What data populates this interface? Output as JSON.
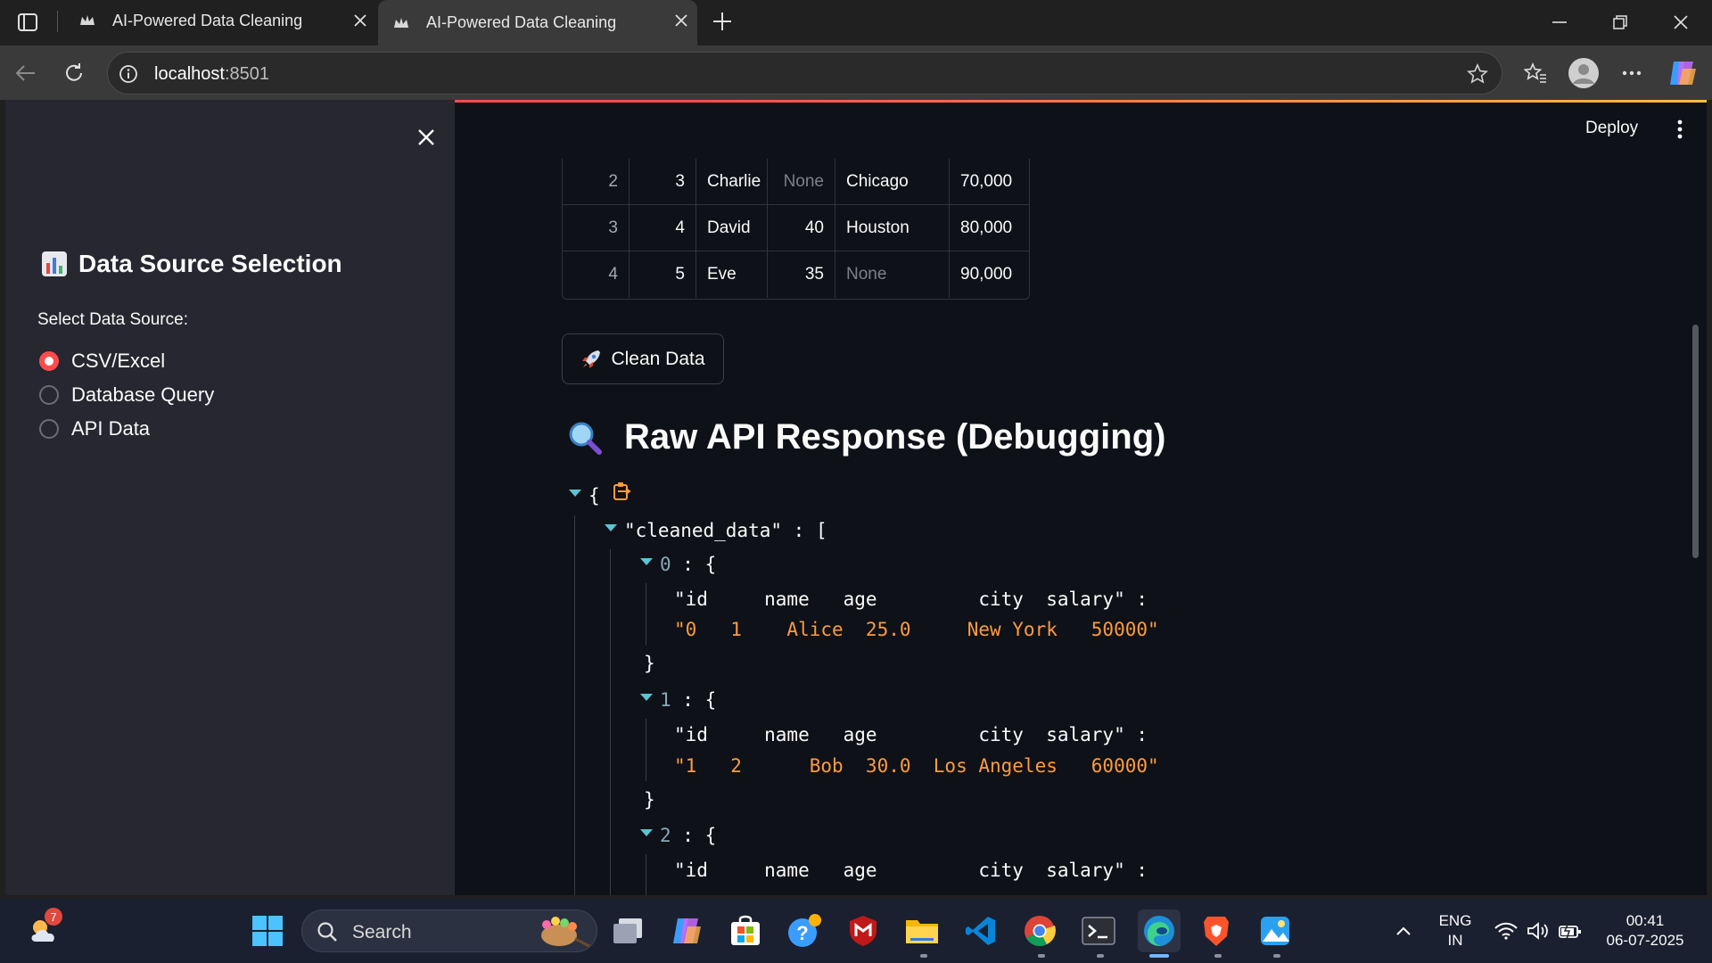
{
  "browser": {
    "tabs": [
      {
        "title": "AI-Powered Data Cleaning"
      },
      {
        "title": "AI-Powered Data Cleaning"
      }
    ],
    "url_host": "localhost",
    "url_port": ":8501"
  },
  "app": {
    "deploy_label": "Deploy",
    "sidebar": {
      "heading": "Data Source Selection",
      "radio_label": "Select Data Source:",
      "options": [
        "CSV/Excel",
        "Database Query",
        "API Data"
      ],
      "selected": "CSV/Excel"
    },
    "dataframe": {
      "rows": [
        {
          "index": "2",
          "id": "3",
          "name": "Charlie",
          "age": "None",
          "city": "Chicago",
          "salary": "70,000"
        },
        {
          "index": "3",
          "id": "4",
          "name": "David",
          "age": "40",
          "city": "Houston",
          "salary": "80,000"
        },
        {
          "index": "4",
          "id": "5",
          "name": "Eve",
          "age": "35",
          "city": "None",
          "salary": "90,000"
        }
      ]
    },
    "clean_button": "Clean Data",
    "section_title": "Raw API Response (Debugging)",
    "json_view": {
      "open_brace": "{",
      "root_key": "\"cleaned_data\"",
      "colon": ":",
      "open_bracket": "[",
      "items": [
        {
          "index": "0",
          "key": "\"id     name   age         city  salary\"",
          "value": "\"0   1    Alice  25.0     New York   50000\""
        },
        {
          "index": "1",
          "key": "\"id     name   age         city  salary\"",
          "value": "\"1   2      Bob  30.0  Los Angeles   60000\""
        },
        {
          "index": "2",
          "key": "\"id     name   age         city  salary\"",
          "value": ""
        }
      ]
    },
    "accent_color": "#ff4b4b"
  },
  "taskbar": {
    "weather_badge": "7",
    "search_placeholder": "Search",
    "lang_line1": "ENG",
    "lang_line2": "IN",
    "time": "00:41",
    "date": "06-07-2025"
  }
}
